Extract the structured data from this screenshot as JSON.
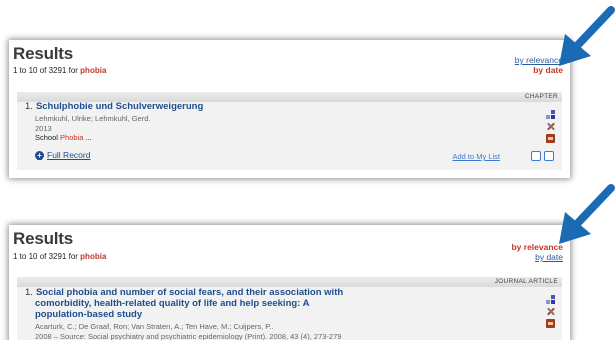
{
  "panels": [
    {
      "results_title": "Results",
      "count_prefix": "1 to 10 of 3291 for",
      "query_term": "phobia",
      "sort_relevance": "by relevance",
      "sort_date": "by date",
      "active_sort": "date",
      "record": {
        "type": "CHAPTER",
        "number": "1.",
        "title_lines": [
          "Schulphobie und Schulverweigerung"
        ],
        "authors": "Lehmkuhl, Ulrike; Lehmkuhl, Gerd.",
        "year": "2013",
        "subject_prefix": "School",
        "subject_term": "Phobia",
        "subject_suffix": "...",
        "full_record": "Full Record",
        "add_to_list": "Add to My List"
      }
    },
    {
      "results_title": "Results",
      "count_prefix": "1 to 10 of 3291 for",
      "query_term": "phobia",
      "sort_relevance": "by relevance",
      "sort_date": "by date",
      "active_sort": "relevance",
      "record": {
        "type": "JOURNAL ARTICLE",
        "number": "1.",
        "title_lines": [
          "Social phobia and number of social fears, and their association with",
          "comorbidity, health-related quality of life and help seeking: A",
          "population-based study"
        ],
        "authors": "Acarturk, C.; De Graaf, Ron; Van Straten, A.; Ten Have, M.; Cuijpers, P..",
        "year": "2008 – Source: Social psychiatry and psychiatric epidemiology (Print). 2008, 43 (4), 273-279"
      }
    }
  ],
  "colors": {
    "link_blue": "#1f4e8c",
    "accent_red": "#c0392b",
    "arrow_blue": "#1a6bb3"
  },
  "icons": [
    "blocks-icon",
    "cross-icon",
    "library-icon",
    "plus-icon",
    "print-icon",
    "document-icon",
    "arrow-icon"
  ]
}
